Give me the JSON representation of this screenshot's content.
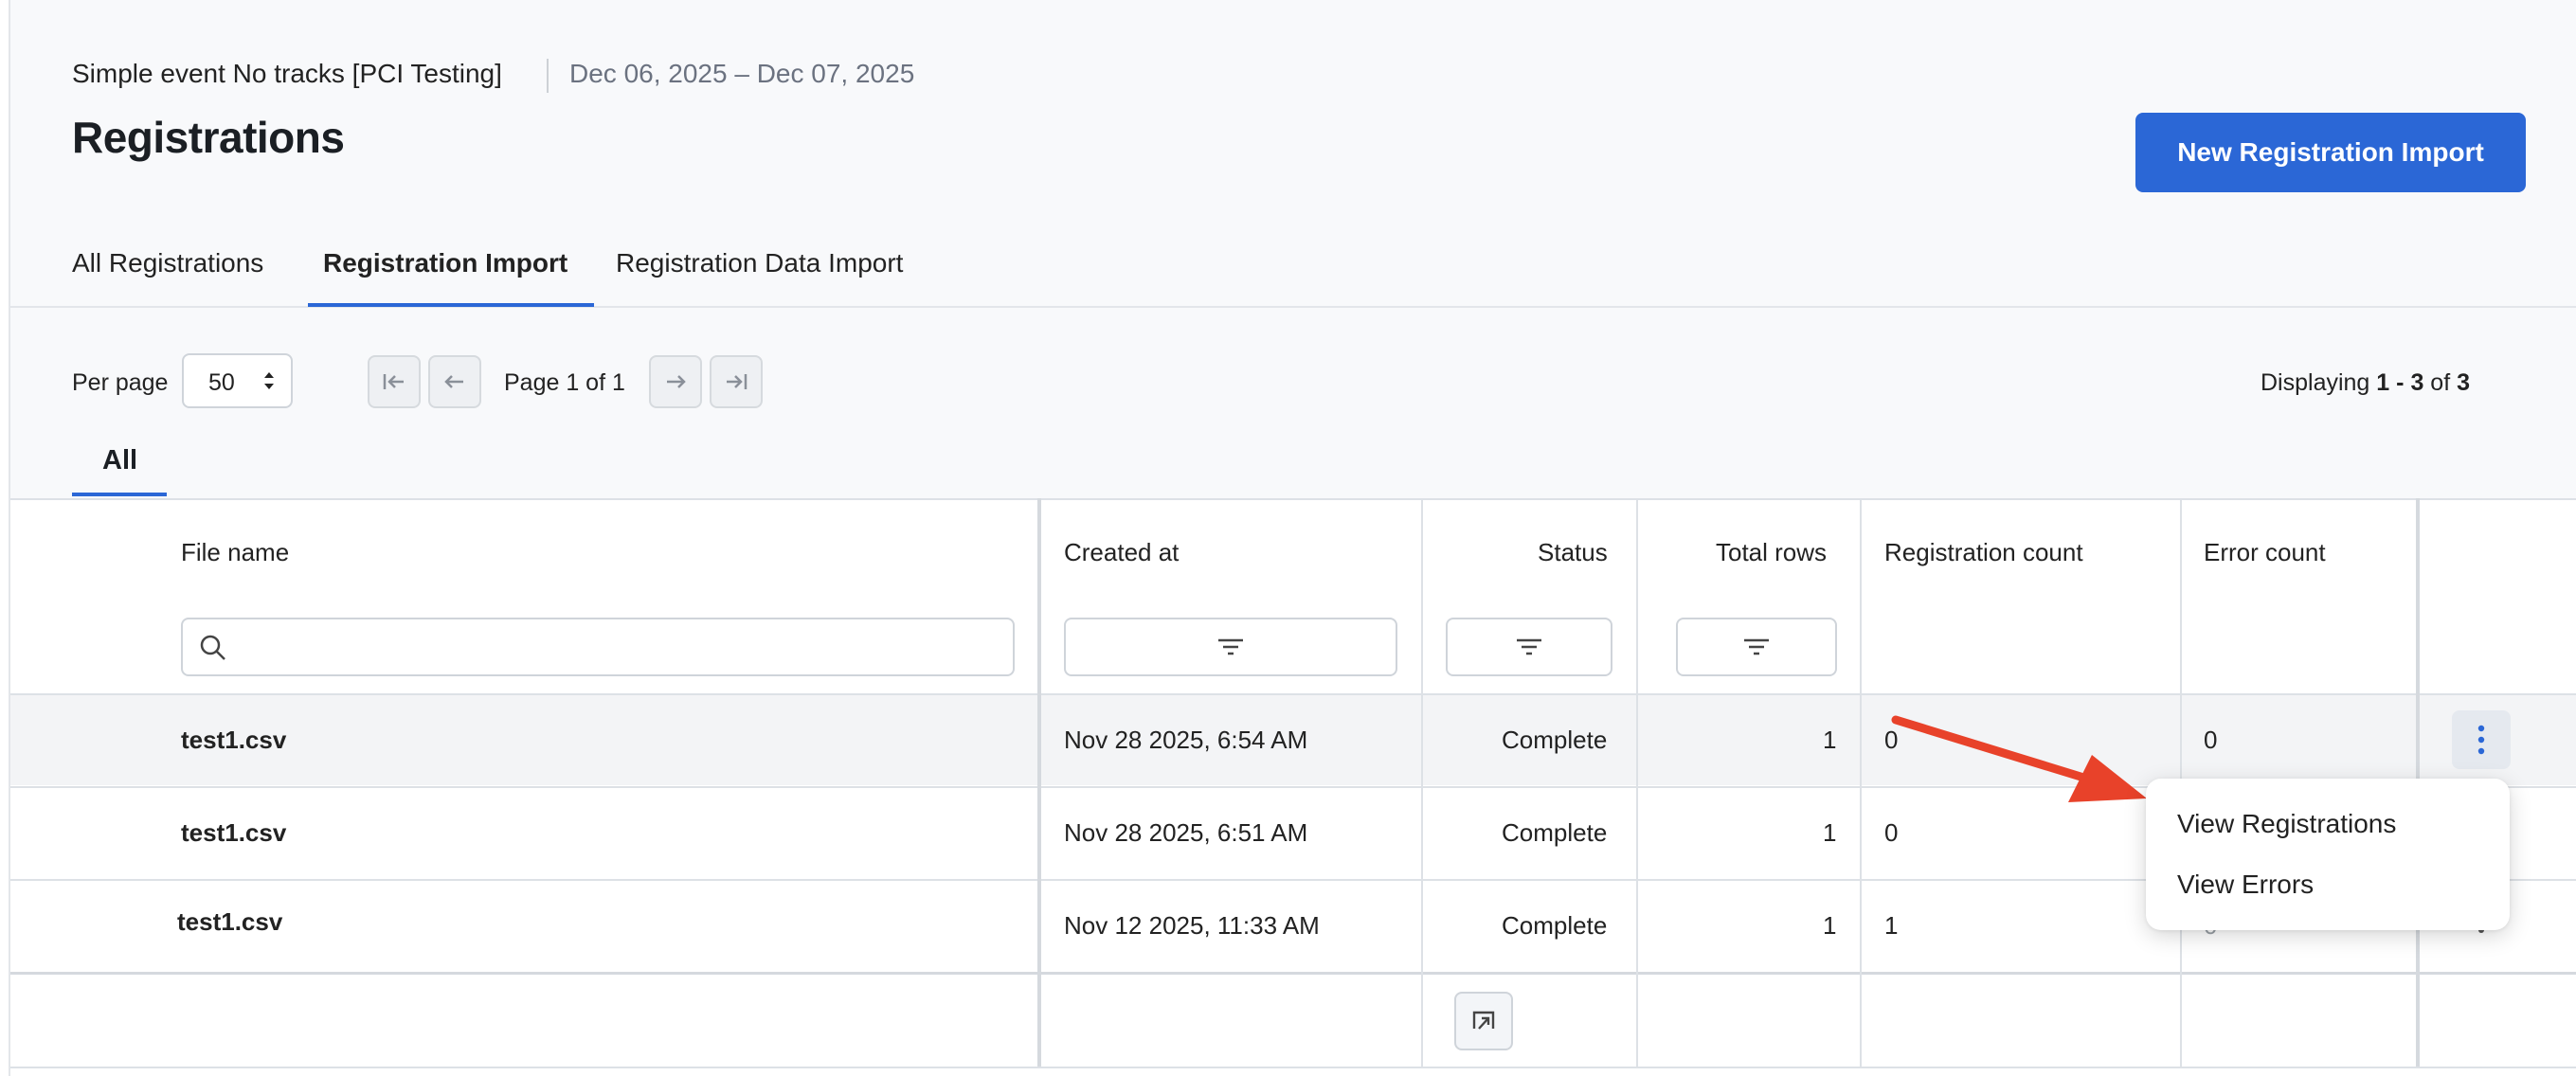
{
  "header": {
    "event_name": "Simple event No tracks [PCI Testing]",
    "date_range": "Dec 06, 2025 – Dec 07, 2025",
    "title": "Registrations",
    "primary_action": "New Registration Import"
  },
  "tabs": [
    {
      "label": "All Registrations",
      "active": false
    },
    {
      "label": "Registration Import",
      "active": true
    },
    {
      "label": "Registration Data Import",
      "active": false
    }
  ],
  "pagination": {
    "per_page_label": "Per page",
    "per_page_value": "50",
    "page_indicator": "Page 1 of 1",
    "displaying_prefix": "Displaying",
    "range_start": "1",
    "range_sep": "-",
    "range_end": "3",
    "of_word": "of",
    "total": "3"
  },
  "filter_tabs": [
    {
      "label": "All",
      "active": true
    }
  ],
  "table": {
    "columns": [
      "File name",
      "Created at",
      "Status",
      "Total rows",
      "Registration count",
      "Error count"
    ],
    "search_placeholder": "",
    "rows": [
      {
        "file_name": "test1.csv",
        "created_at": "Nov 28 2025, 6:54 AM",
        "status": "Complete",
        "total_rows": "1",
        "registration_count": "0",
        "error_count": "0"
      },
      {
        "file_name": "test1.csv",
        "created_at": "Nov 28 2025, 6:51 AM",
        "status": "Complete",
        "total_rows": "1",
        "registration_count": "0",
        "error_count": ""
      },
      {
        "file_name": "test1.csv",
        "created_at": "Nov 12 2025, 11:33 AM",
        "status": "Complete",
        "total_rows": "1",
        "registration_count": "1",
        "error_count": "0"
      }
    ]
  },
  "context_menu": {
    "items": [
      "View Registrations",
      "View Errors"
    ]
  },
  "colors": {
    "accent": "#2b67d6",
    "annotation_arrow": "#e8422a",
    "page_bg": "#f8f9fb"
  },
  "icons": [
    "sort-arrows-icon",
    "first-page-icon",
    "prev-page-icon",
    "next-page-icon",
    "last-page-icon",
    "search-icon",
    "filter-icon",
    "kebab-menu-icon",
    "collapse-panel-icon",
    "annotation-arrow"
  ]
}
